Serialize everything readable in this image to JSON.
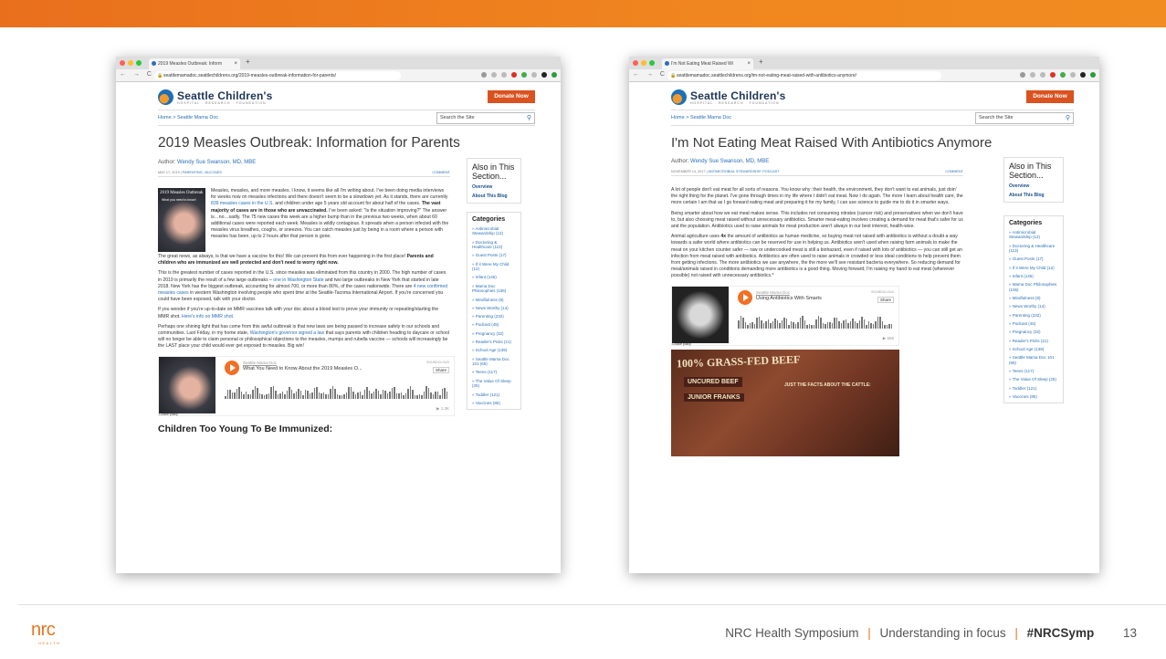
{
  "colors": {
    "accent": "#e97420",
    "link": "#2a6fb7",
    "donate": "#d9521f"
  },
  "left": {
    "tab_title": "2019 Measles Outbreak: Inform",
    "url": "seattlemamadoc.seattlechildrens.org/2019-measles-outbreak-information-for-parents/",
    "logo": "Seattle Children's",
    "logo_sub": "HOSPITAL · RESEARCH · FOUNDATION",
    "donate": "Donate Now",
    "breadcrumb": "Home > Seattle Mama Doc",
    "search_placeholder": "Search the Site",
    "title": "2019 Measles Outbreak: Information for Parents",
    "author_label": "Author:",
    "author": "Wendy Sue Swanson, MD, MBE",
    "date": "MAY 17, 2019",
    "meta_tags": "PARENTING, VACCINES",
    "comment": "COMMENT",
    "thumb_title": "2019 Measles Outbreak",
    "thumb_sub": "What you need to know!",
    "p1": "Measles, measles, and more measles. I know, it seems like all I'm writing about. I've been doing media interviews for weeks now on measles infections and there doesn't seem to be a slowdown yet. As it stands, there are currently",
    "p1_link": "839 measles cases in the U.S.",
    "p1b": "and children under age 5 years old account for about half of the cases.",
    "p1_bold": "The vast majority of cases are in those who are unvaccinated.",
    "p1c": "I've been asked: \"Is the situation improving?\" The answer is…no…sadly. The 75 new cases this week are a higher bump than in the previous two weeks, when about 60 additional cases were reported each week. Measles is wildly contagious. It spreads when a person infected with the measles virus breathes, coughs, or sneezes. You can catch measles just by being in a room where a person with measles has been, up to 2 hours after that person is gone.",
    "p2": "The great news, as always, is that we have a vaccine for this! We can prevent this from ever happening in the first place!",
    "p2_bold": "Parents and children who are immunized are well protected and don't need to worry right now.",
    "p3": "This is the greatest number of cases reported in the U.S. since measles was eliminated from this country in 2000. The high number of cases in 2019 is primarily the result of a few large outbreaks –",
    "p3_link1": "one in Washington State",
    "p3b": "and two large outbreaks in New York that started in late 2018. New York has the biggest outbreak, accounting for almost 700, or more than 80%, of the cases nationwide. There are",
    "p3_link2": "4 new confirmed measles cases",
    "p3c": "in western Washington involving people who spent time at the Seattle-Tacoma International Airport. If you're concerned you could have been exposed, talk with your doctor.",
    "p4": "If you wonder if you're up-to-date on MMR vaccines talk with your doc about a blood test to prove your immunity or repeating/starting the MMR shot.",
    "p4_link": "Here's info on MMR shot.",
    "p5": "Perhaps one shining light that has come from this awful outbreak is that new laws are being passed to increase safety in our schools and communities. Last Friday, in my home state,",
    "p5_link": "Washington's governor signed a law",
    "p5b": "that says parents with children heading to daycare or school will no longer be able to claim personal or philosophical objections to the measles, mumps and rubella vaccine — schools will increasingly be the LAST place your child would ever get exposed to measles. Big win!",
    "sc_user": "Seattle Mama Doc",
    "sc_title": "What You Need to Know About the 2019 Measles O...",
    "sc_logo": "SOUNDCLOUD",
    "sc_share": "Share",
    "sc_plays": "▶ 1.3K",
    "sc_cookie": "Cookie policy",
    "subhead": "Children Too Young To Be Immunized:"
  },
  "right": {
    "tab_title": "I'm Not Eating Meat Raised Wi",
    "url": "seattlemamadoc.seattlechildrens.org/im-not-eating-meat-raised-with-antibiotics-anymore/",
    "title": "I'm Not Eating Meat Raised With Antibiotics Anymore",
    "author": "Wendy Sue Swanson, MD, MBE",
    "date": "NOVEMBER 14, 2017",
    "meta_tags": "ANTIMICROBIAL STEWARDSHIP, PODCAST",
    "p1": "A lot of people don't eat meat for all sorts of reasons. You know why: their health, the environment, they don't want to eat animals, just doin' the right thing for the planet. I've gone through times in my life where I didn't eat meat. Now I do again. The more I learn about health care, the more certain I am that as I go forward eating meat and preparing it for my family, I can use science to guide me to do it in smarter ways.",
    "p2": "Being smarter about how we eat meat makes sense. This includes not consuming nitrates (cancer risk) and preservatives when we don't have to, but also choosing meat raised without unnecessary antibiotics. Smarter meat-eating involves creating a demand for meat that's safer for us and the population. Antibiotics used to raise animals for meat production aren't always in our best interest, health-wise.",
    "p3a": "Animal agriculture uses",
    "p3_bold": "4x",
    "p3b": "the amount of antibiotics as human medicine, so buying meat not raised with antibiotics is without a doubt a way towards a safer world where antibiotics can be reserved for use in helping us. Antibiotics aren't used when raising farm animals to make the meat on your kitchen counter safer — raw or undercooked meat is still a biohazard, even if raised with lots of antibiotics — you can still get an infection from meat raised with antibiotics. Antibiotics are often used to raise animals in crowded or less ideal conditions to help prevent them from getting infections. The more antibiotics we use anywhere, the the more we'll see resistant bacteria everywhere. So reducing demand for meat/animals raised in conditions demanding more antibiotics is a good thing. Moving forward, I'm raising my hand to eat meat (whenever possible) not raised with unnecessary antibiotics.*",
    "sc_user": "Seattle Mama Doc",
    "sc_title": "Using Antibiotics With Smarts",
    "sc_plays": "▶ 555",
    "img_l1": "100% GRASS-FED BEEF",
    "img_l2": "UNCURED BEEF",
    "img_l3": "JUNIOR FRANKS",
    "img_l4": "JUST THE FACTS ABOUT THE CATTLE:"
  },
  "sidebar": {
    "heading": "Also in This Section...",
    "links": [
      "Overview",
      "About This Blog"
    ],
    "categories_heading": "Categories",
    "categories": [
      "Antimicrobial Stewardship (12)",
      "Doctoring & Healthcare (113)",
      "Guest Posts (17)",
      "If it Were My Child (12)",
      "Infant (145)",
      "Mama Doc Philosophies (106)",
      "Mindfulness (8)",
      "News Worthy (14)",
      "Parenting (232)",
      "Podcast (45)",
      "Pregnancy (32)",
      "Reader's Picks (21)",
      "School Age (139)",
      "Seattle Mama Doc 101 (65)",
      "Teens (117)",
      "The Value Of Sleep (25)",
      "Toddler (121)",
      "Vaccines (86)"
    ]
  },
  "footer": {
    "logo": "nrc",
    "logo_sub": "HEALTH",
    "symposium": "NRC Health Symposium",
    "sep": "|",
    "tagline": "Understanding in focus",
    "hashtag": "#NRCSymp",
    "page": "13"
  }
}
